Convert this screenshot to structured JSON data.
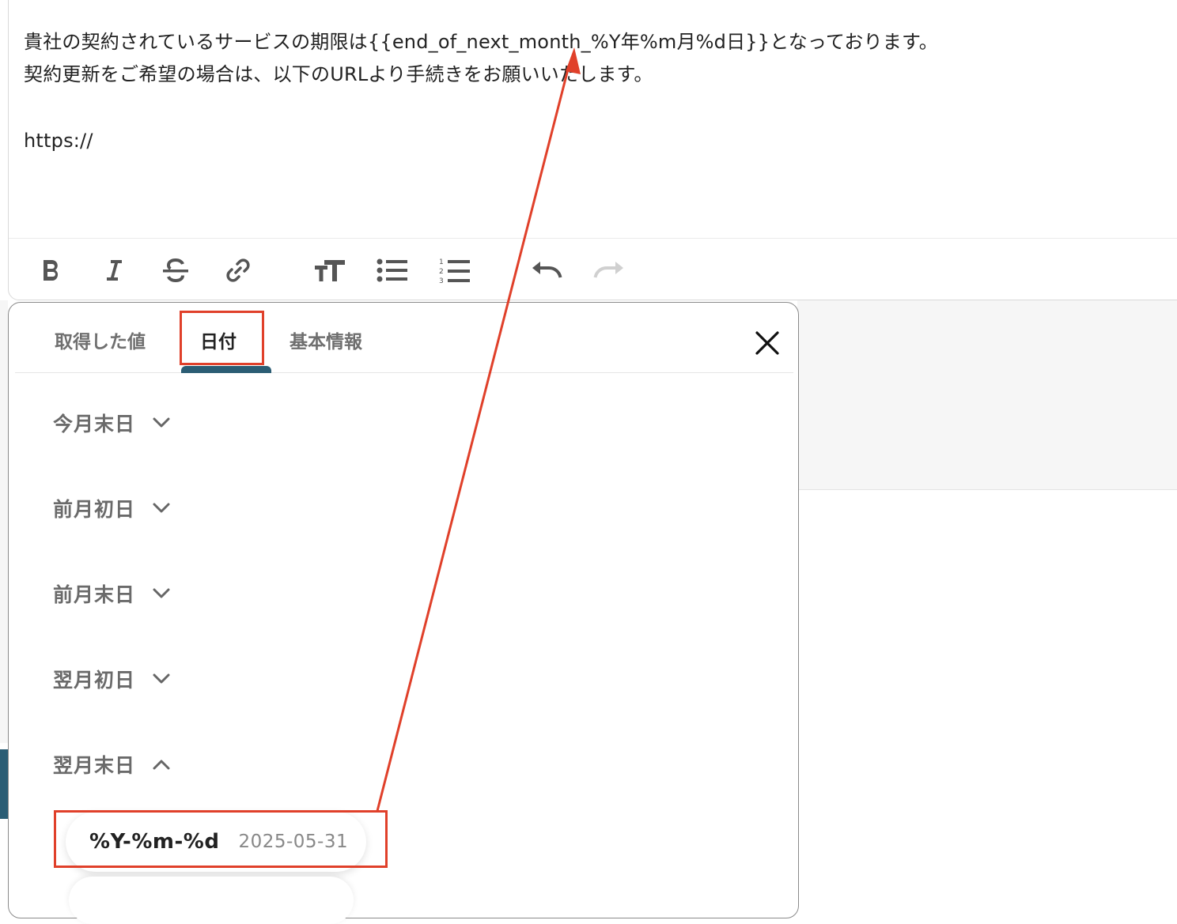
{
  "editor": {
    "lines": [
      "貴社の契約されているサービスの期限は{{end_of_next_month_%Y年%m月%d日}}となっております。",
      "契約更新をご希望の場合は、以下のURLより手続きをお願いいたします。",
      "https://"
    ]
  },
  "toolbar": {
    "buttons": [
      "bold-icon",
      "italic-icon",
      "strikethrough-icon",
      "link-icon",
      "text-size-icon",
      "bullet-list-icon",
      "numbered-list-icon",
      "undo-icon",
      "redo-icon"
    ]
  },
  "panel": {
    "tabs": [
      {
        "label": "取得した値"
      },
      {
        "label": "日付"
      },
      {
        "label": "基本情報"
      }
    ],
    "active_tab": "日付",
    "groups": [
      {
        "label": "今月末日",
        "expanded": false
      },
      {
        "label": "前月初日",
        "expanded": false
      },
      {
        "label": "前月末日",
        "expanded": false
      },
      {
        "label": "翌月初日",
        "expanded": false
      },
      {
        "label": "翌月末日",
        "expanded": true
      }
    ],
    "options": [
      {
        "format": "%Y-%m-%d",
        "sample": "2025-05-31"
      }
    ]
  },
  "colors": {
    "accent": "#2b5d74",
    "annotation": "#e0402a"
  }
}
